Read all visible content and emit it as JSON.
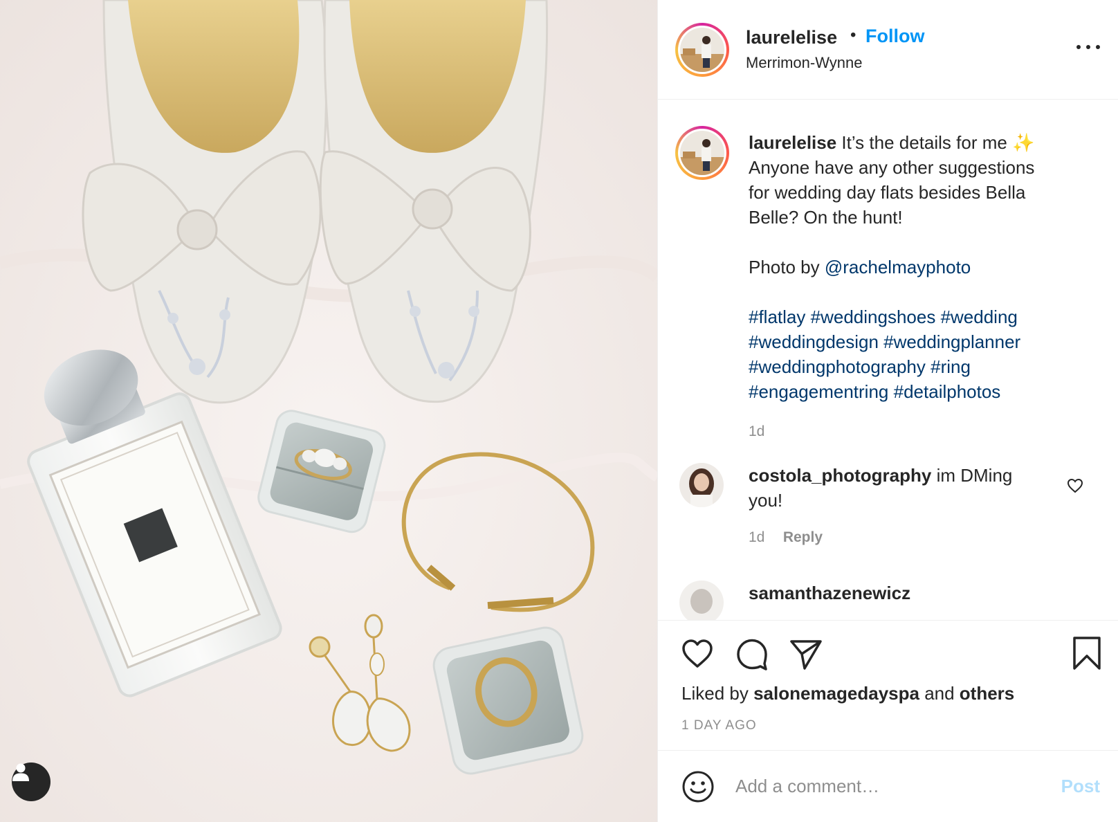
{
  "post": {
    "username": "laurelelise",
    "follow_label": "Follow",
    "bullet": "•",
    "location": "Merrimon-Wynne"
  },
  "caption": {
    "username": "laurelelise",
    "line1": " It’s the details for me ✨",
    "line2": "Anyone have any other suggestions",
    "line3": "for wedding day flats besides Bella",
    "line4": "Belle? On the hunt!",
    "photo_by_prefix": "Photo by ",
    "photo_by_handle": "@rachelmayphoto",
    "hashtags": [
      "#flatlay",
      "#weddingshoes",
      "#wedding",
      "#weddingdesign",
      "#weddingplanner",
      "#weddingphotography",
      "#ring",
      "#engagementring",
      "#detailphotos"
    ],
    "time": "1d"
  },
  "comments": [
    {
      "username": "costola_photography",
      "text": " im DMing",
      "text_line2": "you!",
      "time": "1d",
      "reply_label": "Reply"
    },
    {
      "username": "samanthazenewicz"
    }
  ],
  "actions": {
    "liked_prefix": "Liked by ",
    "liked_user": "salonemagedayspa",
    "liked_middle": " and ",
    "liked_others": "others",
    "time_ago": "1 DAY AGO"
  },
  "composer": {
    "placeholder": "Add a comment…",
    "post_label": "Post"
  },
  "colors": {
    "link": "#00376b",
    "follow": "#0095f6",
    "post_disabled": "#b2dffc",
    "muted": "#8e8e8e"
  },
  "icons": [
    "user-tag-icon",
    "more-options-icon",
    "like-icon",
    "comment-icon",
    "share-icon",
    "save-icon",
    "comment-like-icon",
    "emoji-icon"
  ]
}
